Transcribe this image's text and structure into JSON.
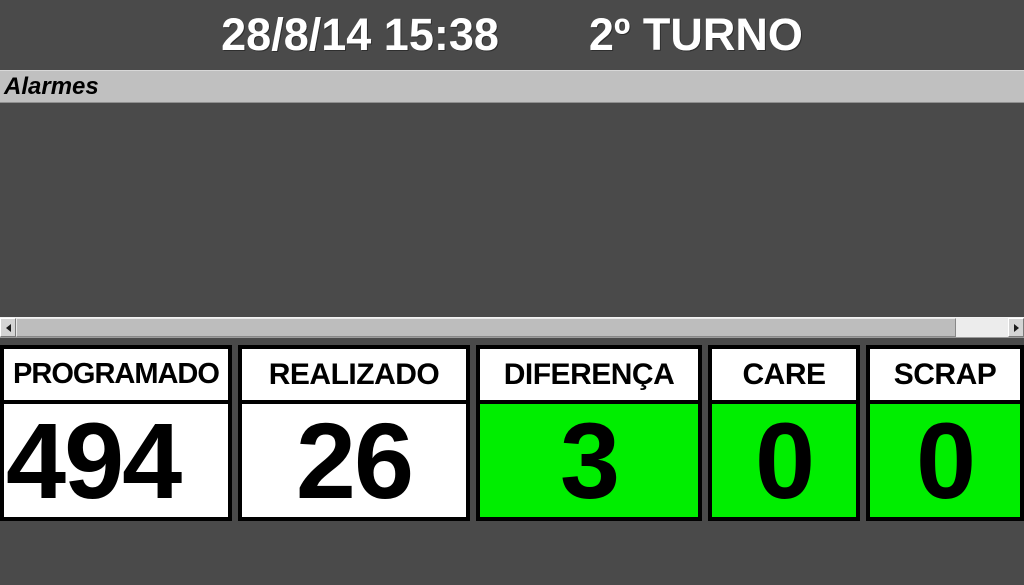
{
  "header": {
    "datetime": "28/8/14 15:38",
    "shift": "2º TURNO"
  },
  "alarms": {
    "title": "Alarmes",
    "rows": []
  },
  "scrollbar": {
    "left_arrow_icon": "triangle-left-icon",
    "right_arrow_icon": "triangle-right-icon"
  },
  "kpis": [
    {
      "label": "PROGRAMADO",
      "value": "494",
      "bg": "#ffffff"
    },
    {
      "label": "REALIZADO",
      "value": "26",
      "bg": "#ffffff"
    },
    {
      "label": "DIFERENÇA",
      "value": "3",
      "bg": "#00ee00"
    },
    {
      "label": "CARE",
      "value": "0",
      "bg": "#00ee00"
    },
    {
      "label": "SCRAP",
      "value": "0",
      "bg": "#00ee00"
    }
  ],
  "colors": {
    "background": "#4a4a4a",
    "header_text": "#ffffff",
    "alarm_bar": "#c0c0c0",
    "ok_green": "#00ee00",
    "panel_border": "#000000"
  }
}
